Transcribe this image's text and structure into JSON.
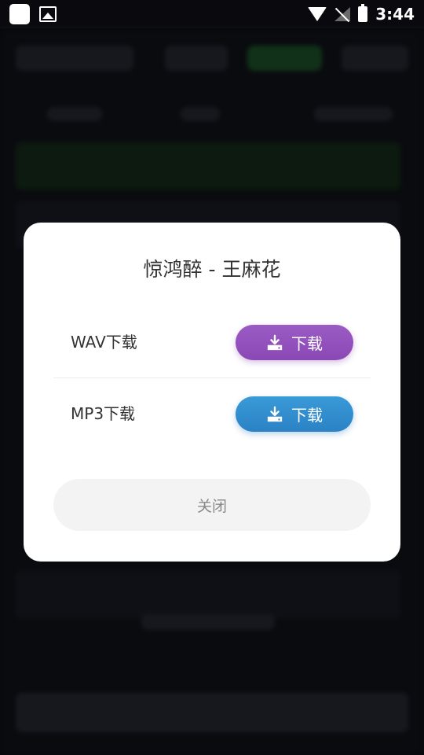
{
  "status_bar": {
    "time": "3:44",
    "icons": [
      "app-square-icon",
      "image-icon",
      "wifi-icon",
      "no-signal-icon",
      "battery-charging-icon"
    ]
  },
  "dialog": {
    "title": "惊鸿醉 - 王麻花",
    "options": [
      {
        "label": "WAV下载",
        "button_label": "下载",
        "button_color": "#9151BD",
        "icon": "download-icon"
      },
      {
        "label": "MP3下载",
        "button_label": "下载",
        "button_color": "#308DCF",
        "icon": "download-icon"
      }
    ],
    "close_label": "关闭"
  }
}
